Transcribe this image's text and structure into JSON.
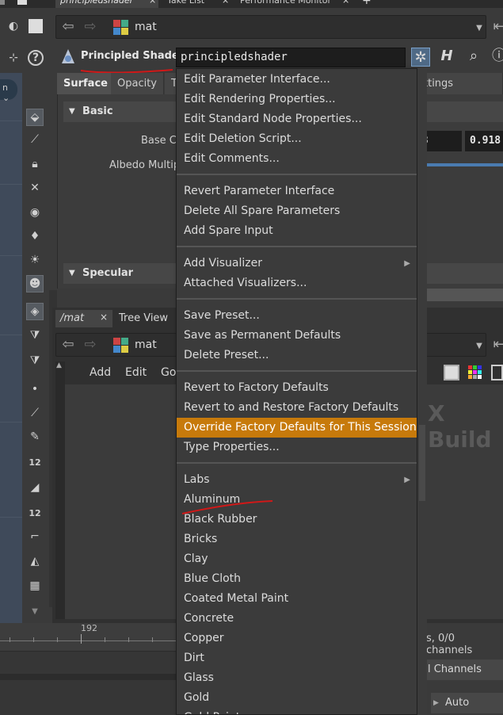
{
  "top_tabs": [
    {
      "label": "principledshader",
      "active": true
    },
    {
      "label": "Take List",
      "active": false
    },
    {
      "label": "Performance Monitor",
      "active": false
    }
  ],
  "params_pane": {
    "path": "mat",
    "node_type": "Principled Shader",
    "node_name": "principledshader",
    "tabs": [
      "Surface",
      "Opacity",
      "T",
      "ttings"
    ],
    "folders": {
      "basic": "Basic",
      "specular": "Specular"
    },
    "labels": {
      "base_color": "Base Co",
      "albedo": "Albedo Multip"
    },
    "fields": {
      "base_color_partial": "3",
      "base_color_value": "0.918"
    }
  },
  "network_pane": {
    "tabs": [
      "/mat",
      "Tree View"
    ],
    "path": "mat",
    "menu": [
      "Add",
      "Edit",
      "Go"
    ],
    "watermark": "X Build"
  },
  "timeline": {
    "frame_label": "192"
  },
  "bottom_bar": {
    "channels_status": "s, 0/0 channels",
    "channels_button": "l Channels",
    "auto_update": "Auto Update"
  },
  "shelf_numbers": [
    "12",
    "12"
  ],
  "context_menu": {
    "groups": [
      [
        "Edit Parameter Interface...",
        "Edit Rendering Properties...",
        "Edit Standard Node Properties...",
        "Edit Deletion Script...",
        "Edit Comments..."
      ],
      [
        "Revert Parameter Interface",
        "Delete All Spare Parameters",
        "Add Spare Input"
      ],
      [
        "Add Visualizer",
        "Attached Visualizers..."
      ],
      [
        "Save Preset...",
        "Save as Permanent Defaults",
        "Delete Preset..."
      ],
      [
        "Revert to Factory Defaults",
        "Revert to and Restore Factory Defaults",
        "Override Factory Defaults for This Session",
        "Type Properties..."
      ],
      [
        "Labs",
        "Aluminum",
        "Black Rubber",
        "Bricks",
        "Clay",
        "Blue Cloth",
        "Coated Metal Paint",
        "Concrete",
        "Copper",
        "Dirt",
        "Glass",
        "Gold",
        "Gold Paint"
      ]
    ],
    "highlighted": "Override Factory Defaults for This Session",
    "submenu_items": [
      "Add Visualizer",
      "Labs"
    ]
  },
  "colors": {
    "highlight": "#c77a0b",
    "annotation_red": "#d01818",
    "menu_bg": "#3b3b3b"
  }
}
